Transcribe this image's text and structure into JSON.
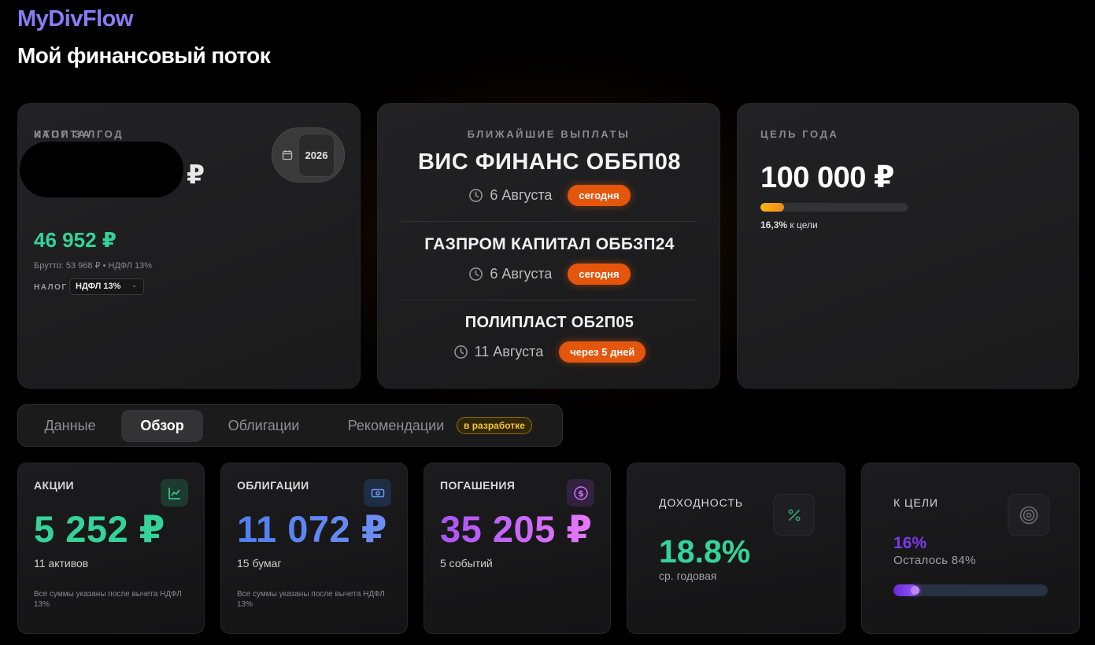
{
  "app": {
    "brand": "MyDivFlow",
    "title": "Мой финансовый поток"
  },
  "capital": {
    "label": "КАПИТАЛ",
    "value_redacted": true,
    "currency": "₽",
    "year": "2026",
    "calendar_icon": "calendar-icon",
    "total_label": "ИТОГ ЗА ГОД",
    "total_value": "46 952 ₽",
    "gross_text": "Брутто: 53 968 ₽ • НДФЛ 13%",
    "tax_label": "НАЛОГ",
    "tax_selected": "НДФЛ 13%"
  },
  "payouts": {
    "label": "БЛИЖАЙШИЕ ВЫПЛАТЫ",
    "items": [
      {
        "name": "ВИС ФИНАНС ОББП08",
        "date": "6 Августа",
        "badge": "сегодня"
      },
      {
        "name": "ГАЗПРОМ КАПИТАЛ ОББЗП24",
        "date": "6 Августа",
        "badge": "сегодня"
      },
      {
        "name": "ПОЛИПЛАСТ ОБ2П05",
        "date": "11 Августа",
        "badge": "через 5 дней"
      }
    ]
  },
  "goal": {
    "label": "ЦЕЛЬ ГОДА",
    "value": "100 000 ₽",
    "progress_pct": "16,3%",
    "progress_fraction": 0.163,
    "caption_suffix": "к цели"
  },
  "tabs": {
    "items": [
      "Данные",
      "Обзор",
      "Облигации",
      "Рекомендации"
    ],
    "active": "Обзор",
    "dev_badge": "в разработке"
  },
  "stats": {
    "stocks": {
      "label": "АКЦИИ",
      "value": "5 252 ₽",
      "sub": "11 активов",
      "note": "Все суммы указаны после вычета НДФЛ 13%",
      "icon": "chart-line-icon",
      "color": "#34d399"
    },
    "bonds": {
      "label": "ОБЛИГАЦИИ",
      "value": "11 072 ₽",
      "sub": "15 бумаг",
      "note": "Все суммы указаны после вычета НДФЛ 13%",
      "icon": "banknote-icon",
      "color": "#5b8def"
    },
    "repayments": {
      "label": "ПОГАШЕНИЯ",
      "value": "35 205 ₽",
      "sub": "5 событий",
      "icon": "dollar-coin-icon",
      "color": "#b45ef0"
    },
    "yield": {
      "label": "ДОХОДНОСТЬ",
      "value": "18.8%",
      "sub": "ср. годовая",
      "icon": "percent-icon",
      "color": "#36d399"
    },
    "to_goal": {
      "label": "К ЦЕЛИ",
      "value": "16%",
      "remaining": "Осталось 84%",
      "progress_fraction": 0.16,
      "icon": "target-icon",
      "color": "#7c3aed"
    }
  }
}
